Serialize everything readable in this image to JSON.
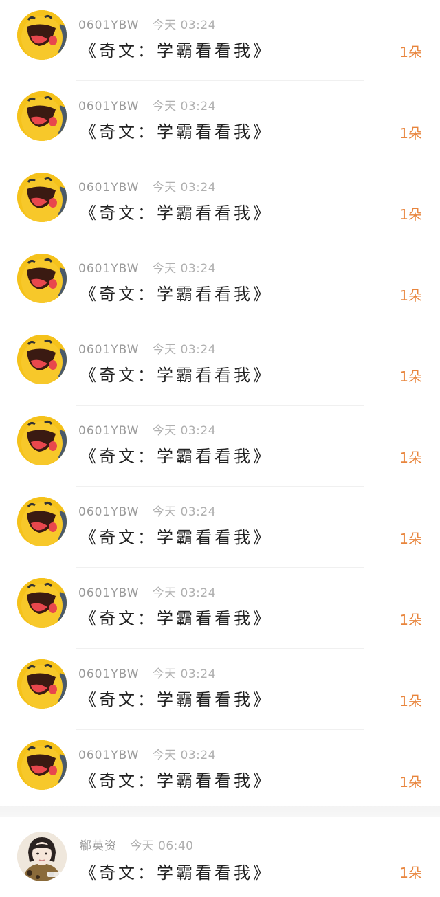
{
  "messages": [
    {
      "username": "0601YBW",
      "time": "今天 03:24",
      "text": "《奇文：学霸看看我》",
      "gift": "1朵",
      "avatar_icon": "laughing-yellow-cartoon-avatar"
    },
    {
      "username": "0601YBW",
      "time": "今天 03:24",
      "text": "《奇文：学霸看看我》",
      "gift": "1朵",
      "avatar_icon": "laughing-yellow-cartoon-avatar"
    },
    {
      "username": "0601YBW",
      "time": "今天 03:24",
      "text": "《奇文：学霸看看我》",
      "gift": "1朵",
      "avatar_icon": "laughing-yellow-cartoon-avatar"
    },
    {
      "username": "0601YBW",
      "time": "今天 03:24",
      "text": "《奇文：学霸看看我》",
      "gift": "1朵",
      "avatar_icon": "laughing-yellow-cartoon-avatar"
    },
    {
      "username": "0601YBW",
      "time": "今天 03:24",
      "text": "《奇文：学霸看看我》",
      "gift": "1朵",
      "avatar_icon": "laughing-yellow-cartoon-avatar"
    },
    {
      "username": "0601YBW",
      "time": "今天 03:24",
      "text": "《奇文：学霸看看我》",
      "gift": "1朵",
      "avatar_icon": "laughing-yellow-cartoon-avatar"
    },
    {
      "username": "0601YBW",
      "time": "今天 03:24",
      "text": "《奇文：学霸看看我》",
      "gift": "1朵",
      "avatar_icon": "laughing-yellow-cartoon-avatar"
    },
    {
      "username": "0601YBW",
      "time": "今天 03:24",
      "text": "《奇文：学霸看看我》",
      "gift": "1朵",
      "avatar_icon": "laughing-yellow-cartoon-avatar"
    },
    {
      "username": "0601YBW",
      "time": "今天 03:24",
      "text": "《奇文：学霸看看我》",
      "gift": "1朵",
      "avatar_icon": "laughing-yellow-cartoon-avatar"
    },
    {
      "username": "0601YBW",
      "time": "今天 03:24",
      "text": "《奇文：学霸看看我》",
      "gift": "1朵",
      "avatar_icon": "laughing-yellow-cartoon-avatar"
    }
  ],
  "last_message": {
    "username": "郗英资",
    "time": "今天 06:40",
    "text": "《奇文：学霸看看我》",
    "gift": "1朵",
    "avatar_icon": "girl-photo-avatar"
  },
  "colors": {
    "gift": "#e8853d",
    "username": "#9a9a9a",
    "message": "#222222"
  }
}
